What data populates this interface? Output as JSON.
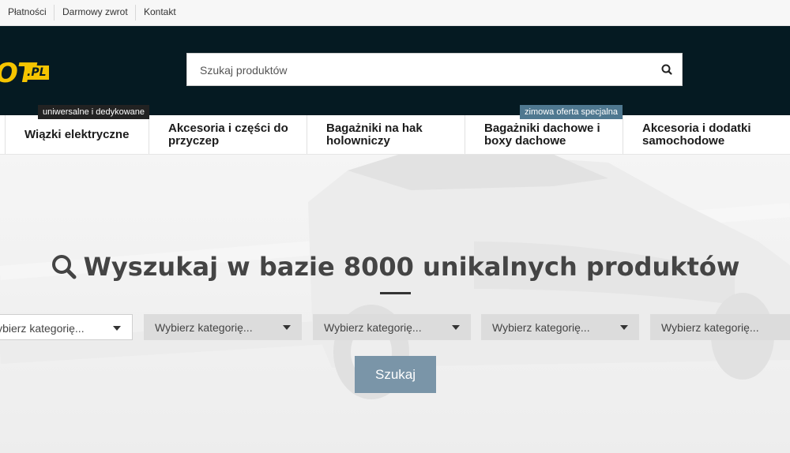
{
  "topbar": {
    "links": [
      "Płatności",
      "Darmowy zwrot",
      "Kontakt"
    ]
  },
  "logo": {
    "text_main": "OT",
    "text_suffix": ".PL"
  },
  "search": {
    "placeholder": "Szukaj produktów",
    "value": "",
    "icon": "search-icon"
  },
  "nav": {
    "items": [
      {
        "label": "Wiązki elektryczne"
      },
      {
        "label": "Akcesoria i części do przyczep"
      },
      {
        "label": "Bagażniki na hak holowniczy"
      },
      {
        "label": "Bagażniki dachowe i boxy dachowe"
      },
      {
        "label": "Akcesoria i dodatki samochodowe"
      }
    ],
    "badges": [
      {
        "text": "uniwersalne i dedykowane",
        "color": "#222222"
      },
      {
        "text": "zimowa oferta specjalna",
        "color": "#4f7890"
      }
    ]
  },
  "hero": {
    "title": "Wyszukaj w bazie 8000 unikalnych produktów",
    "selects": [
      {
        "value": "Wybierz kategorię..."
      },
      {
        "value": "Wybierz kategorię..."
      },
      {
        "value": "Wybierz kategorię..."
      },
      {
        "value": "Wybierz kategorię..."
      },
      {
        "value": "Wybierz kategorię..."
      }
    ],
    "submit_label": "Szukaj"
  },
  "colors": {
    "header_bg": "#051a22",
    "brand_yellow": "#f5c400",
    "submit_bg": "#7a95a8"
  }
}
